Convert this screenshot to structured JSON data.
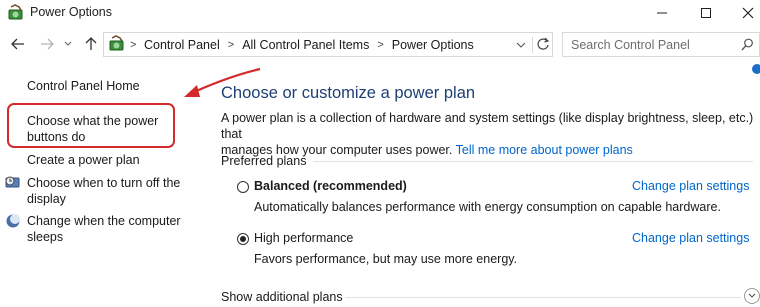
{
  "window": {
    "title": "Power Options",
    "icons": [
      "power-options-icon",
      "minimize-icon",
      "maximize-icon",
      "close-icon"
    ]
  },
  "navigation": {
    "back_icon": "back-arrow-icon",
    "forward_icon": "forward-arrow-icon",
    "recent_icon": "chevron-down-icon",
    "up_icon": "up-arrow-icon",
    "breadcrumbs": [
      "Control Panel",
      "All Control Panel Items",
      "Power Options"
    ],
    "search_placeholder": "Search Control Panel"
  },
  "sidebar": {
    "home": "Control Panel Home",
    "items": [
      {
        "label_line1": "Choose what the power",
        "label_line2": "buttons do"
      },
      {
        "label_line1": "Create a power plan"
      },
      {
        "label_line1": "Choose when to turn off the",
        "label_line2": "display",
        "icon": "monitor-clock-icon"
      },
      {
        "label_line1": "Change when the computer",
        "label_line2": "sleeps",
        "icon": "moon-sleep-icon"
      }
    ]
  },
  "main": {
    "title": "Choose or customize a power plan",
    "description_line1": "A power plan is a collection of hardware and system settings (like display brightness, sleep, etc.) that",
    "description_line2": "manages how your computer uses power.",
    "learn_more": "Tell me more about power plans",
    "preferred_label": "Preferred plans",
    "plans": [
      {
        "name": "Balanced (recommended)",
        "bold": true,
        "selected": false,
        "description": "Automatically balances performance with energy consumption on capable hardware.",
        "link": "Change plan settings"
      },
      {
        "name": "High performance",
        "bold": false,
        "selected": true,
        "description": "Favors performance, but may use more energy.",
        "link": "Change plan settings"
      }
    ],
    "show_additional": "Show additional plans"
  },
  "colors": {
    "accent_link": "#0066cc",
    "title_blue": "#1e3f73",
    "annotation_red": "#d52a2a"
  }
}
